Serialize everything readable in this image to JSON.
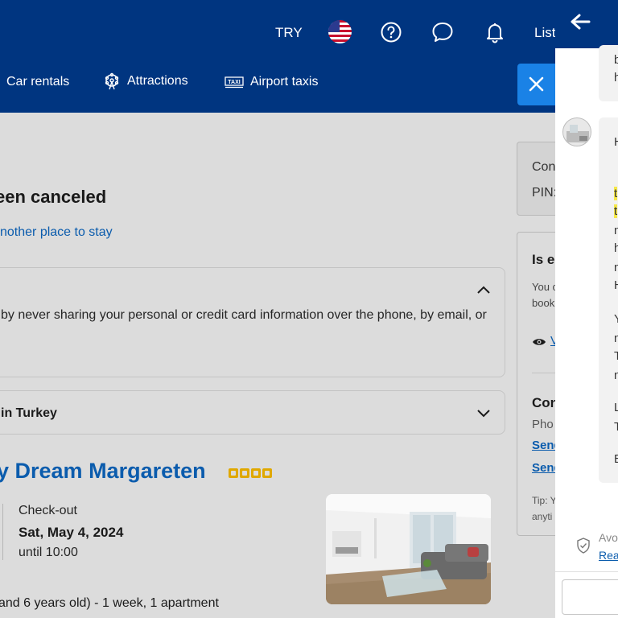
{
  "header": {
    "currency": "TRY",
    "list_label": "List",
    "nav": [
      {
        "label": "Car rentals",
        "icon": "car-icon"
      },
      {
        "label": "Attractions",
        "icon": "attractions-icon"
      },
      {
        "label": "Airport taxis",
        "icon": "taxi-icon"
      }
    ],
    "taxi_icon_text": "TAXI"
  },
  "page": {
    "title": "een canceled",
    "another_place_link": "nother place to stay",
    "safety_text": "by never sharing your personal or credit card information over the phone, by email, or",
    "collapsed_section": "in Turkey",
    "hotel_name": "y Dream Margareten",
    "hotel_star_rating": 4,
    "checkout_label": "Check-out",
    "checkout_date": "Sat, May 4, 2024",
    "checkout_time": "until 10:00",
    "guests_summary": "and 6 years old) - 1 week, 1 apartment"
  },
  "right": {
    "pin_line1": "Con",
    "pin_line2": "PIN:",
    "card_heading": "Is e",
    "card_line1": "You c",
    "card_line2": "book",
    "view_link": "V",
    "contact_heading": "Con",
    "phone_label": "Pho",
    "send_link_1": "Send",
    "send_link_2": "Send",
    "tip_line1": "Tip: Y",
    "tip_line2": "anyti"
  },
  "chat": {
    "bubble1": [
      "b",
      "h"
    ],
    "bubble2": [
      {
        "t": "H",
        "hl": false
      },
      {
        "t": "t",
        "hl": true
      },
      {
        "t": "t",
        "hl": true
      },
      {
        "t": "n",
        "hl": false
      },
      {
        "t": "h",
        "hl": false
      },
      {
        "t": "n",
        "hl": false
      },
      {
        "t": "H",
        "hl": false
      },
      {
        "t": "Y",
        "hl": false
      },
      {
        "t": "n",
        "hl": false
      },
      {
        "t": "T",
        "hl": false
      },
      {
        "t": "n",
        "hl": false
      },
      {
        "t": "L",
        "hl": false
      },
      {
        "t": "T",
        "hl": false
      },
      {
        "t": "E",
        "hl": false
      }
    ],
    "avoid_text": "Avoi",
    "read_link": "Read"
  },
  "colors": {
    "brand_blue": "#003580",
    "link_blue": "#0b5cad",
    "close_button": "#1a82e6",
    "star_yellow": "#e0a800",
    "highlight_yellow": "#f6e94a"
  }
}
